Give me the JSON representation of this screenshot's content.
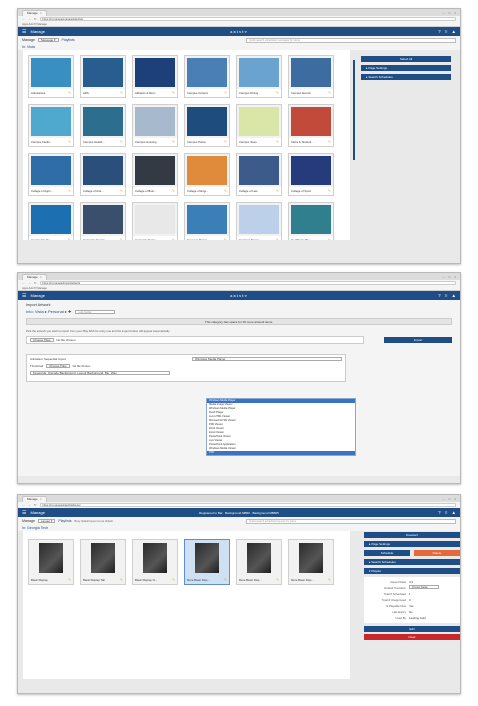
{
  "browser": {
    "tab_title": "Manage",
    "tab_close": "×",
    "window_controls": [
      "–",
      "□",
      "×"
    ],
    "nav_icons": [
      "←",
      "→",
      "↻"
    ],
    "url1": "https://pr-manage/manage/playlists",
    "url2": "https://pr-manage/import/artwork",
    "url3": "https://pr-manage/playlists/layout",
    "bookmarks": "Apps   AxisTV Manage"
  },
  "app": {
    "menu_icon": "☰",
    "title": "Manage",
    "brand": "axistv",
    "actions": [
      "?",
      "⁝⁝",
      "▲"
    ]
  },
  "screen1": {
    "manage_label": "Manage",
    "mode": "Message ▾",
    "playlists_link": "Playlists",
    "search_placeholder": "Quick search scheduled messages by name",
    "location": "In: Vista",
    "tiles": [
      {
        "label": "Admissions",
        "color": "#3a8fc2"
      },
      {
        "label": "ADS",
        "color": "#2a5d8f"
      },
      {
        "label": "Athletics & Recr...",
        "color": "#1d3f7a"
      },
      {
        "label": "Campus Centers",
        "color": "#4a7fb5"
      },
      {
        "label": "Campus Dining",
        "color": "#6aa3d0"
      },
      {
        "label": "Campus Events",
        "color": "#3d6ca0"
      },
      {
        "label": "Campus Facilit...",
        "color": "#4fa9cf"
      },
      {
        "label": "Campus Health...",
        "color": "#2c6e8e"
      },
      {
        "label": "Campus Housing",
        "color": "#a7b9cc"
      },
      {
        "label": "Campus Police",
        "color": "#1e4d7d"
      },
      {
        "label": "Campus Store",
        "color": "#d9e6a8"
      },
      {
        "label": "Clubs & Student...",
        "color": "#c24a3a"
      },
      {
        "label": "College of Agric...",
        "color": "#2e6da8"
      },
      {
        "label": "College of Arts...",
        "color": "#2a4f7a"
      },
      {
        "label": "College of Busi...",
        "color": "#333a44"
      },
      {
        "label": "College of Engi...",
        "color": "#e08a3c"
      },
      {
        "label": "College of Law",
        "color": "#3c5b8a"
      },
      {
        "label": "College of Sport",
        "color": "#263b7c"
      },
      {
        "label": "Community Ou...",
        "color": "#1c6fb0"
      },
      {
        "label": "Corporate Events",
        "color": "#3a4f6b"
      },
      {
        "label": "Corporate Notes",
        "color": "#e8e8e8"
      },
      {
        "label": "Coupons Popup...",
        "color": "#3a7fb8"
      },
      {
        "label": "Customs Popup...",
        "color": "#bcd0ea"
      },
      {
        "label": "Healthcare Pro...",
        "color": "#2f7f8f"
      }
    ],
    "side": [
      "Select All",
      "▸  Page Settings",
      "▸  Search Schedules"
    ]
  },
  "screen2": {
    "heading": "Import Artwork",
    "breadcrumb": "Into: Vista  ▸  Personal  ▸  ✚",
    "subfolder_placeholder": "sub-folder",
    "info": "This category has space for 26 more artwork items.",
    "instruction": "Pick the artwork you wish to import from your Play With Us entry one and the import button will appear automatically",
    "choose_files": "Choose Files",
    "no_file": "No file chosen",
    "import_button": "Import",
    "animation_label": "Animation: Sequential Import",
    "animation_value": "Windows Media Player",
    "thumbnail_label": "Thumbnail",
    "thumbnail_files": "Choose Files",
    "thumbnail_no_file": "No file chosen",
    "keywords": "Keywords, Unicode Background, Layout Background, Bio, Wax",
    "dropdown_options": [
      "Windows Media Player",
      "Media Image Viewer",
      "Windows Media Player",
      "Flash Player",
      "Live HTML Viewer",
      "Microsoft HTML Viewer",
      "PDF Viewer",
      "Word Viewer",
      "Excel Viewer",
      "PowerPoint Viewer",
      "Live Viewer",
      "PowerPoint Application",
      "Windows Media Viewer",
      "PDF"
    ]
  },
  "screen3": {
    "manage_label": "Manage",
    "mode": "Layout ▾",
    "playlists_link": "Playlists",
    "header_info": "Registered to Bar · Background MB60 · Background MB605",
    "sub_info": "Busy default layout set as default",
    "search_placeholder": "Quick search scheduled layouts by name",
    "location": "In: Georgia Tech",
    "tiles": [
      {
        "label": "Basic Display"
      },
      {
        "label": "Basic Display Tall"
      },
      {
        "label": "Basic Display %..."
      },
      {
        "label": "More Basic Disp..."
      },
      {
        "label": "More Basic Disp..."
      },
      {
        "label": "More Basic Disp..."
      }
    ],
    "side_top": "Deselect",
    "page_settings": "▸  Page Settings",
    "schedule_btn": "Schedule",
    "delete_btn": "Delete",
    "search_schedules": "▸  Search Schedules",
    "playlist_header": "▾  Playlist",
    "props": [
      {
        "k": "Aspect Ratio",
        "v": "4:3"
      },
      {
        "k": "Default Transition",
        "v": "Cross Fade"
      },
      {
        "k": "Total # Scheduled",
        "v": "1"
      },
      {
        "k": "Total # Unapproved",
        "v": "0"
      },
      {
        "k": "Is Playable Now",
        "v": "Yes"
      },
      {
        "k": "Has Expiry",
        "v": "No"
      },
      {
        "k": "Used By",
        "v": "Landing Gold"
      }
    ],
    "edit_btn": "Edit",
    "clear_btn": "Clear"
  },
  "colors": {
    "primary": "#1f4e87",
    "accent_pencil": "#e4a11b",
    "orange": "#e46a3c",
    "red": "#c8282a"
  }
}
